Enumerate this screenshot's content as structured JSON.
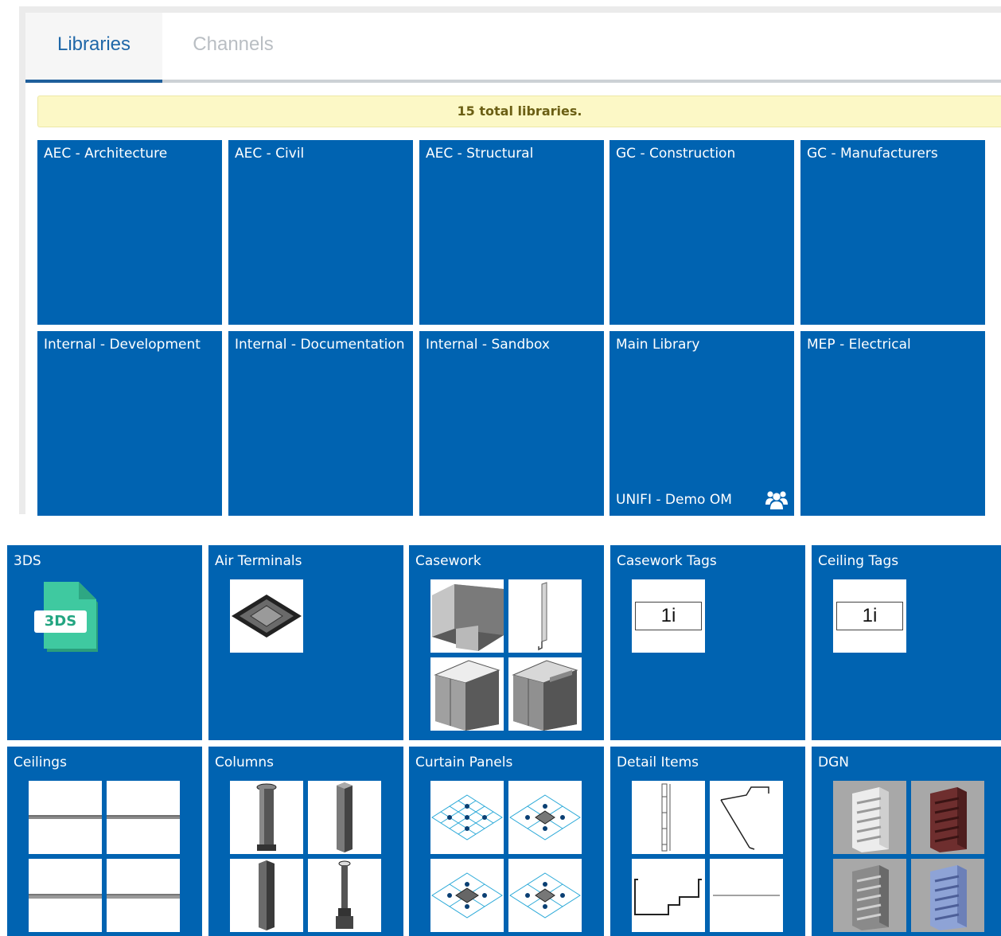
{
  "tabs": [
    {
      "label": "Libraries",
      "active": true
    },
    {
      "label": "Channels",
      "active": false
    }
  ],
  "banner": {
    "text": "15 total libraries."
  },
  "libraries": [
    {
      "name": "AEC - Architecture"
    },
    {
      "name": "AEC - Civil"
    },
    {
      "name": "AEC - Structural"
    },
    {
      "name": "GC - Construction"
    },
    {
      "name": "GC - Manufacturers"
    },
    {
      "name": "Internal - Development"
    },
    {
      "name": "Internal - Documentation"
    },
    {
      "name": "Internal - Sandbox"
    },
    {
      "name": "Main Library",
      "subtitle": "UNIFI - Demo OM",
      "icon": "users-group-icon"
    },
    {
      "name": "MEP - Electrical"
    }
  ],
  "categories": [
    {
      "name": "3DS",
      "icon": "3ds-file-icon",
      "file_label": "3DS"
    },
    {
      "name": "Air Terminals"
    },
    {
      "name": "Casework"
    },
    {
      "name": "Casework Tags",
      "tag_text": "1i"
    },
    {
      "name": "Ceiling Tags",
      "tag_text": "1i"
    },
    {
      "name": "Ceilings"
    },
    {
      "name": "Columns"
    },
    {
      "name": "Curtain Panels"
    },
    {
      "name": "Detail Items"
    },
    {
      "name": "DGN"
    }
  ],
  "colors": {
    "tile_blue": "#0063b1",
    "tab_active": "#1f67a8",
    "tab_inactive": "#b9bec3",
    "banner_bg": "#fcf8c6",
    "banner_text": "#6b5f14",
    "file_icon_green": "#3fc9a0"
  }
}
